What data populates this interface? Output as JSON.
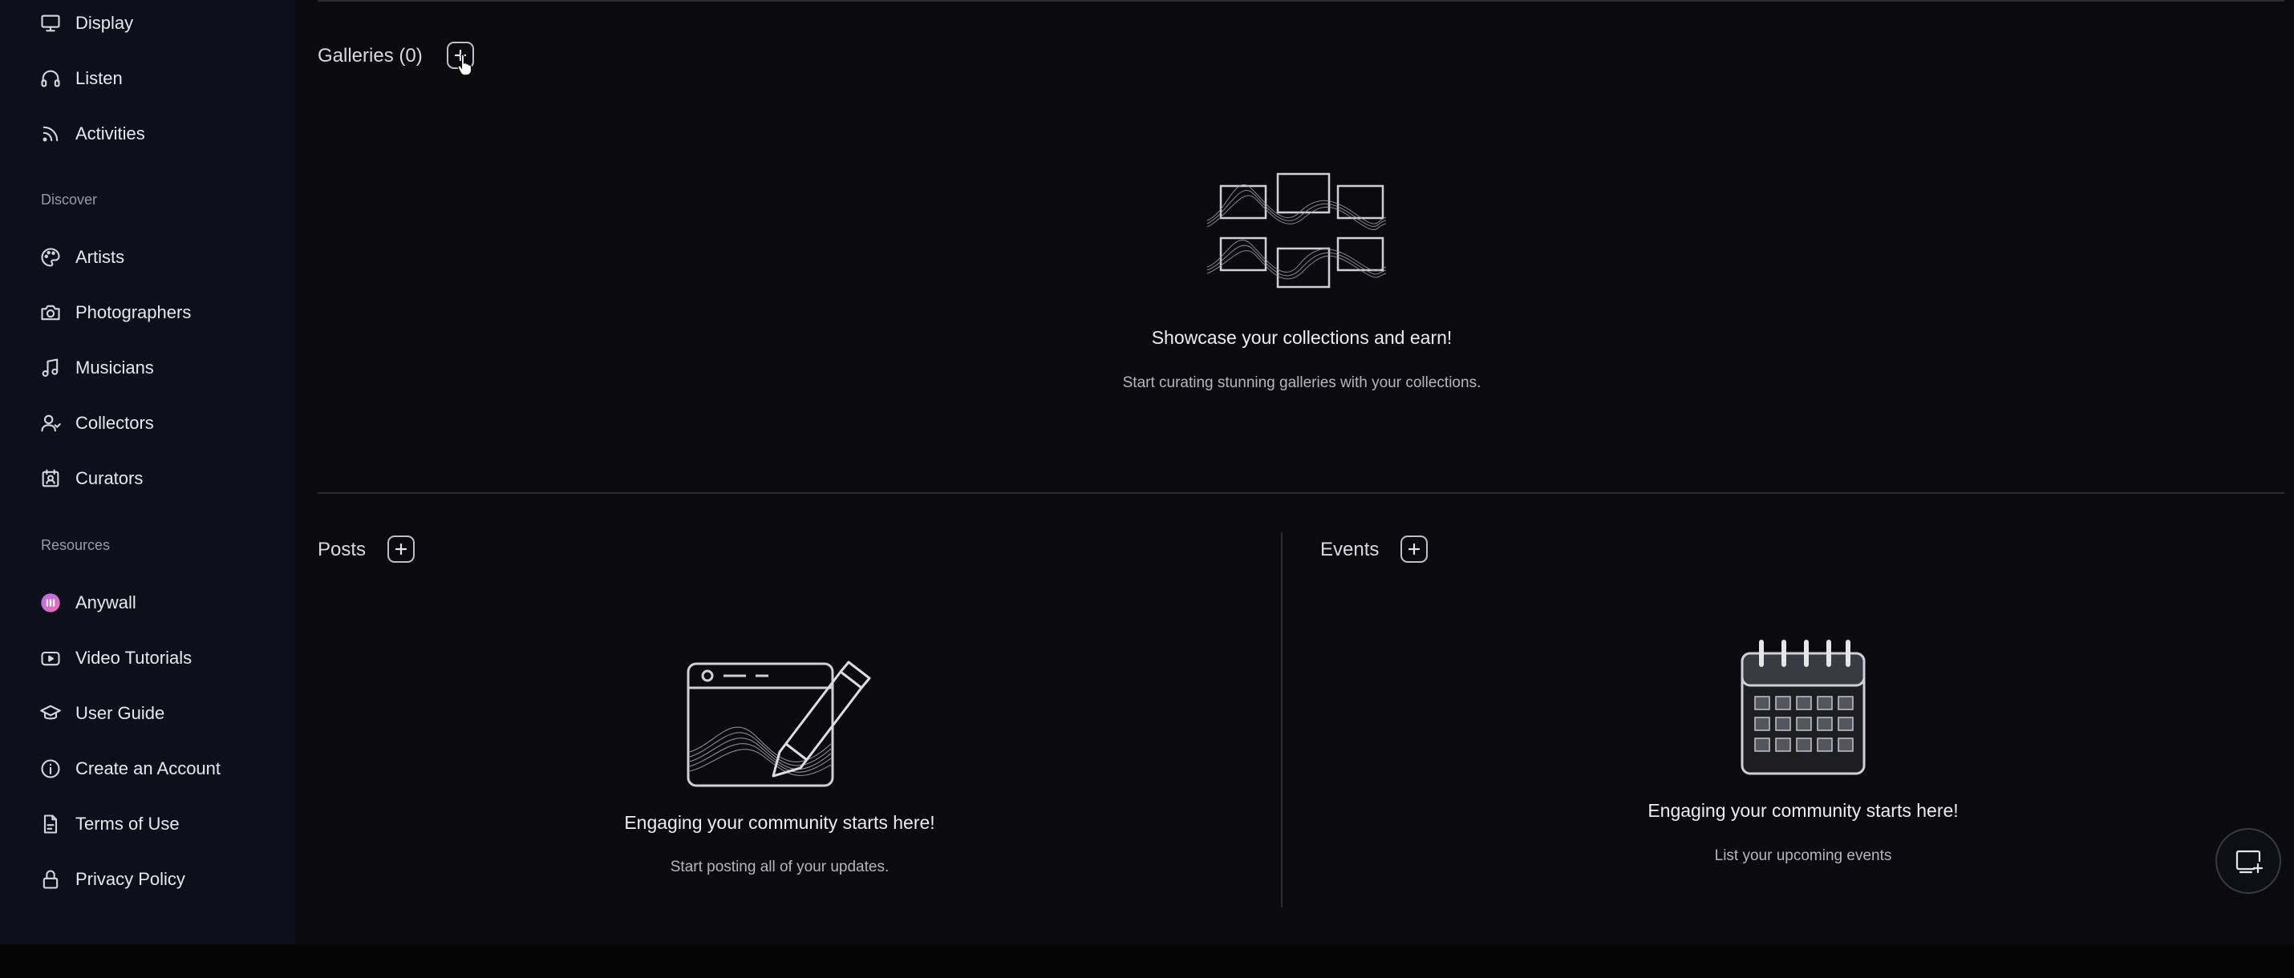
{
  "sidebar": {
    "items_top": [
      {
        "label": "Display",
        "icon": "monitor-icon"
      },
      {
        "label": "Listen",
        "icon": "headphones-icon"
      },
      {
        "label": "Activities",
        "icon": "rss-icon"
      }
    ],
    "discover_label": "Discover",
    "discover_items": [
      {
        "label": "Artists",
        "icon": "palette-icon"
      },
      {
        "label": "Photographers",
        "icon": "camera-icon"
      },
      {
        "label": "Musicians",
        "icon": "music-note-icon"
      },
      {
        "label": "Collectors",
        "icon": "user-icon"
      },
      {
        "label": "Curators",
        "icon": "curator-icon"
      }
    ],
    "resources_label": "Resources",
    "resources_items": [
      {
        "label": "Anywall",
        "icon": "anywall-logo-icon"
      },
      {
        "label": "Video Tutorials",
        "icon": "youtube-icon"
      },
      {
        "label": "User Guide",
        "icon": "graduation-cap-icon"
      },
      {
        "label": "Create an Account",
        "icon": "info-icon"
      },
      {
        "label": "Terms of Use",
        "icon": "document-icon"
      },
      {
        "label": "Privacy Policy",
        "icon": "lock-icon"
      }
    ]
  },
  "galleries": {
    "title": "Galleries (0)",
    "empty_title": "Showcase your collections and earn!",
    "empty_subtitle": "Start curating stunning galleries with your collections."
  },
  "posts": {
    "title": "Posts",
    "empty_title": "Engaging your community starts here!",
    "empty_subtitle": "Start posting all of your updates."
  },
  "events": {
    "title": "Events",
    "empty_title": "Engaging your community starts here!",
    "empty_subtitle": "List your upcoming events"
  },
  "colors": {
    "background": "#0b0b0f",
    "sidebar": "#0d0f1a",
    "text": "#e6e6ea",
    "muted": "#9a9aa8"
  }
}
